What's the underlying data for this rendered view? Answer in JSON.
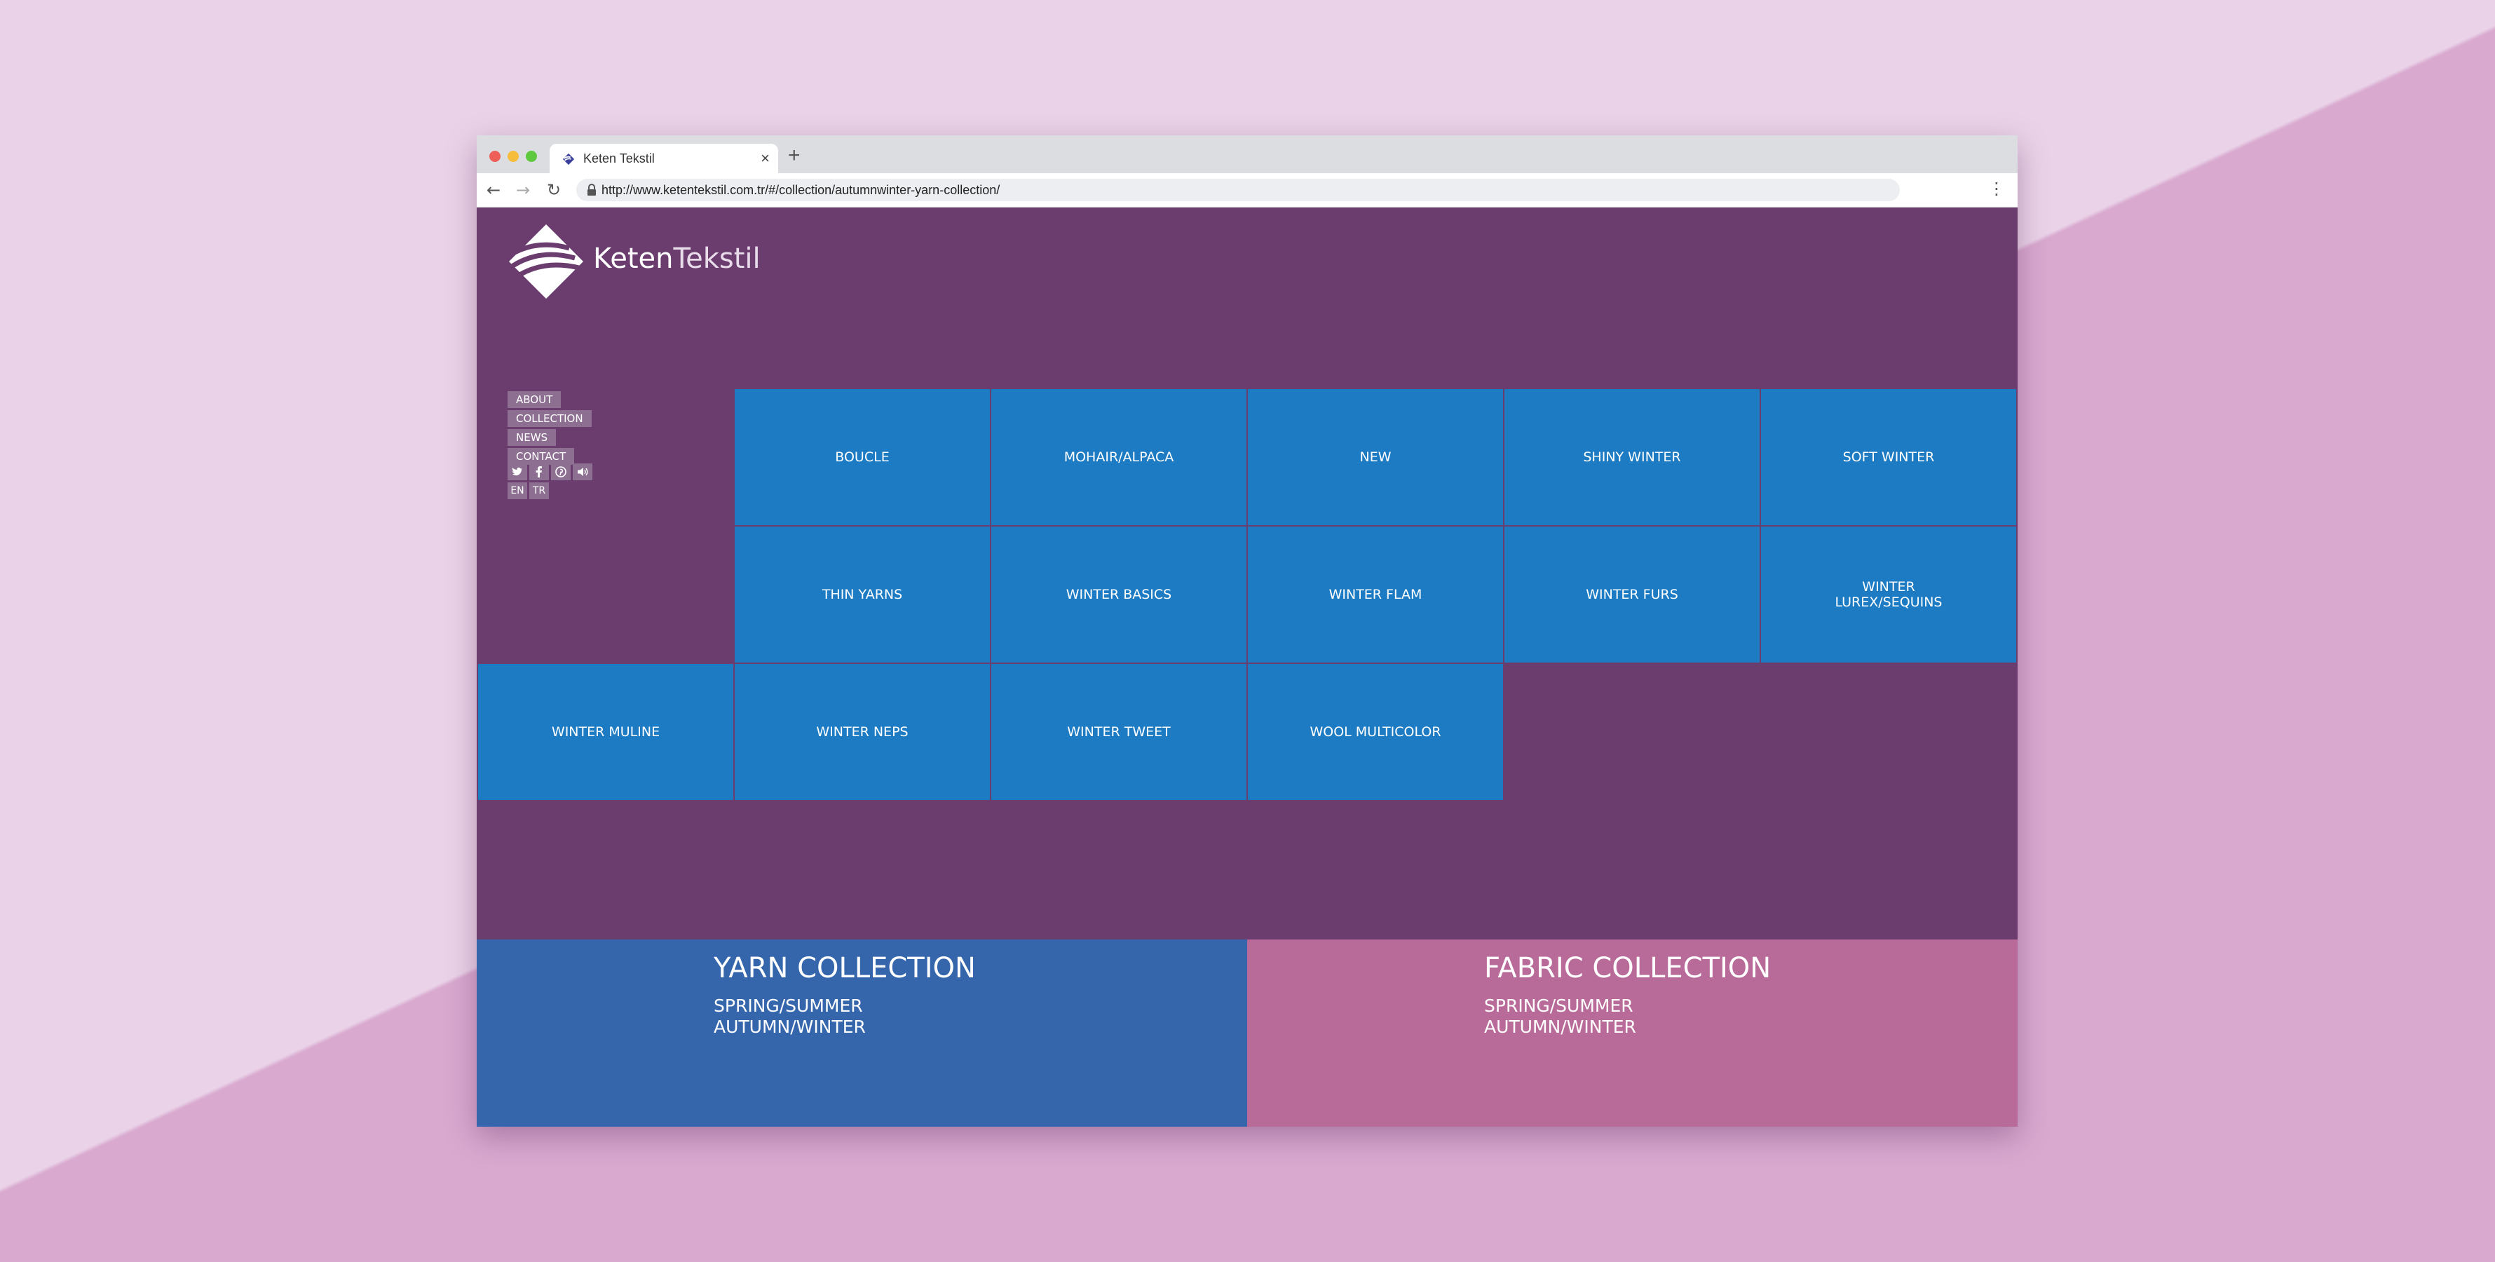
{
  "browser": {
    "tab_title": "Keten Tekstil",
    "tab_close": "×",
    "new_tab": "+",
    "url": "http://www.ketentekstil.com.tr/#/collection/autumnwinter-yarn-collection/",
    "back": "←",
    "forward": "→",
    "reload": "↻",
    "menu": "⋮"
  },
  "brand": {
    "bold": "Keten",
    "light": "Tekstil"
  },
  "nav": {
    "items": [
      "ABOUT",
      "COLLECTION",
      "NEWS",
      "CONTACT"
    ],
    "social": [
      "twitter-icon",
      "facebook-icon",
      "pinterest-icon",
      "sound-icon"
    ],
    "languages": [
      "EN",
      "TR"
    ]
  },
  "tiles": [
    "BOUCLE",
    "MOHAIR/ALPACA",
    "NEW",
    "SHINY WINTER",
    "SOFT WINTER",
    "THIN YARNS",
    "WINTER BASICS",
    "WINTER FLAM",
    "WINTER FURS",
    "WINTER\nLUREX/SEQUINS",
    "WINTER MULINE",
    "WINTER NEPS",
    "WINTER TWEET",
    "WOOL MULTICOLOR"
  ],
  "collections": {
    "yarn": {
      "title": "YARN COLLECTION",
      "line1": "SPRING/SUMMER",
      "line2": "AUTUMN/WINTER",
      "color": "#3566ab"
    },
    "fabric": {
      "title": "FABRIC COLLECTION",
      "line1": "SPRING/SUMMER",
      "line2": "AUTUMN/WINTER",
      "color": "#b86b98"
    }
  },
  "colors": {
    "page_bg": "#6a3d6e",
    "tile": "#1c7bc3",
    "nav_bg": "#8d6f92"
  }
}
